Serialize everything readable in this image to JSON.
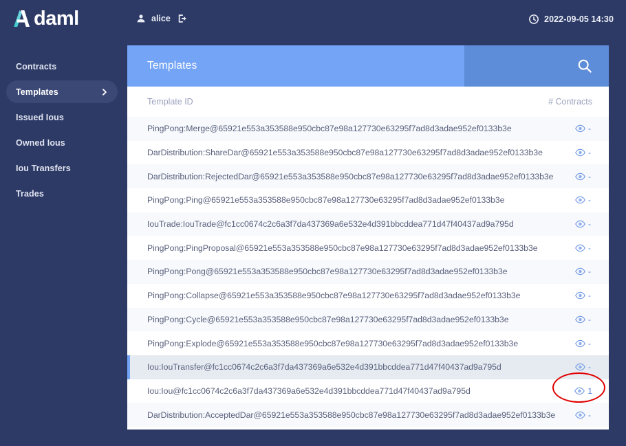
{
  "brand": {
    "logo_text": "daml",
    "logo_icon": "daml-a-logo",
    "accent_teal": "#3fc6c6",
    "accent_blue": "#74a4f5",
    "bg_navy": "#2d3a66"
  },
  "topbar": {
    "user_icon": "person-icon",
    "user_name": "alice",
    "logout_icon": "logout-icon",
    "clock_icon": "clock-icon",
    "timestamp": "2022-09-05 14:30"
  },
  "sidebar": {
    "items": [
      {
        "label": "Contracts",
        "active": false
      },
      {
        "label": "Templates",
        "active": true,
        "chevron_icon": "chevron-right-icon"
      },
      {
        "label": "Issued Ious",
        "active": false
      },
      {
        "label": "Owned Ious",
        "active": false
      },
      {
        "label": "Iou Transfers",
        "active": false
      },
      {
        "label": "Trades",
        "active": false
      }
    ]
  },
  "panel": {
    "title": "Templates",
    "search_icon": "search-icon",
    "columns": {
      "template_id": "Template ID",
      "contracts": "# Contracts"
    },
    "rows": [
      {
        "template_id": "PingPong:Merge@65921e553a353588e950cbc87e98a127730e63295f7ad8d3adae952ef0133b3e",
        "count": "-",
        "eye_icon": "eye-icon"
      },
      {
        "template_id": "DarDistribution:ShareDar@65921e553a353588e950cbc87e98a127730e63295f7ad8d3adae952ef0133b3e",
        "count": "-",
        "eye_icon": "eye-icon"
      },
      {
        "template_id": "DarDistribution:RejectedDar@65921e553a353588e950cbc87e98a127730e63295f7ad8d3adae952ef0133b3e",
        "count": "-",
        "eye_icon": "eye-icon"
      },
      {
        "template_id": "PingPong:Ping@65921e553a353588e950cbc87e98a127730e63295f7ad8d3adae952ef0133b3e",
        "count": "-",
        "eye_icon": "eye-icon"
      },
      {
        "template_id": "IouTrade:IouTrade@fc1cc0674c2c6a3f7da437369a6e532e4d391bbcddea771d47f40437ad9a795d",
        "count": "-",
        "eye_icon": "eye-icon"
      },
      {
        "template_id": "PingPong:PingProposal@65921e553a353588e950cbc87e98a127730e63295f7ad8d3adae952ef0133b3e",
        "count": "-",
        "eye_icon": "eye-icon"
      },
      {
        "template_id": "PingPong:Pong@65921e553a353588e950cbc87e98a127730e63295f7ad8d3adae952ef0133b3e",
        "count": "-",
        "eye_icon": "eye-icon"
      },
      {
        "template_id": "PingPong:Collapse@65921e553a353588e950cbc87e98a127730e63295f7ad8d3adae952ef0133b3e",
        "count": "-",
        "eye_icon": "eye-icon"
      },
      {
        "template_id": "PingPong:Cycle@65921e553a353588e950cbc87e98a127730e63295f7ad8d3adae952ef0133b3e",
        "count": "-",
        "eye_icon": "eye-icon"
      },
      {
        "template_id": "PingPong:Explode@65921e553a353588e950cbc87e98a127730e63295f7ad8d3adae952ef0133b3e",
        "count": "-",
        "eye_icon": "eye-icon"
      },
      {
        "template_id": "Iou:IouTransfer@fc1cc0674c2c6a3f7da437369a6e532e4d391bbcddea771d47f40437ad9a795d",
        "count": "-",
        "eye_icon": "eye-icon",
        "selected": true
      },
      {
        "template_id": "Iou:Iou@fc1cc0674c2c6a3f7da437369a6e532e4d391bbcddea771d47f40437ad9a795d",
        "count": "1",
        "eye_icon": "eye-icon",
        "annotated": true
      },
      {
        "template_id": "DarDistribution:AcceptedDar@65921e553a353588e950cbc87e98a127730e63295f7ad8d3adae952ef0133b3e",
        "count": "-",
        "eye_icon": "eye-icon"
      }
    ]
  },
  "annotation": {
    "shape": "ellipse",
    "color": "#e00000",
    "targets_row_index": 11
  }
}
